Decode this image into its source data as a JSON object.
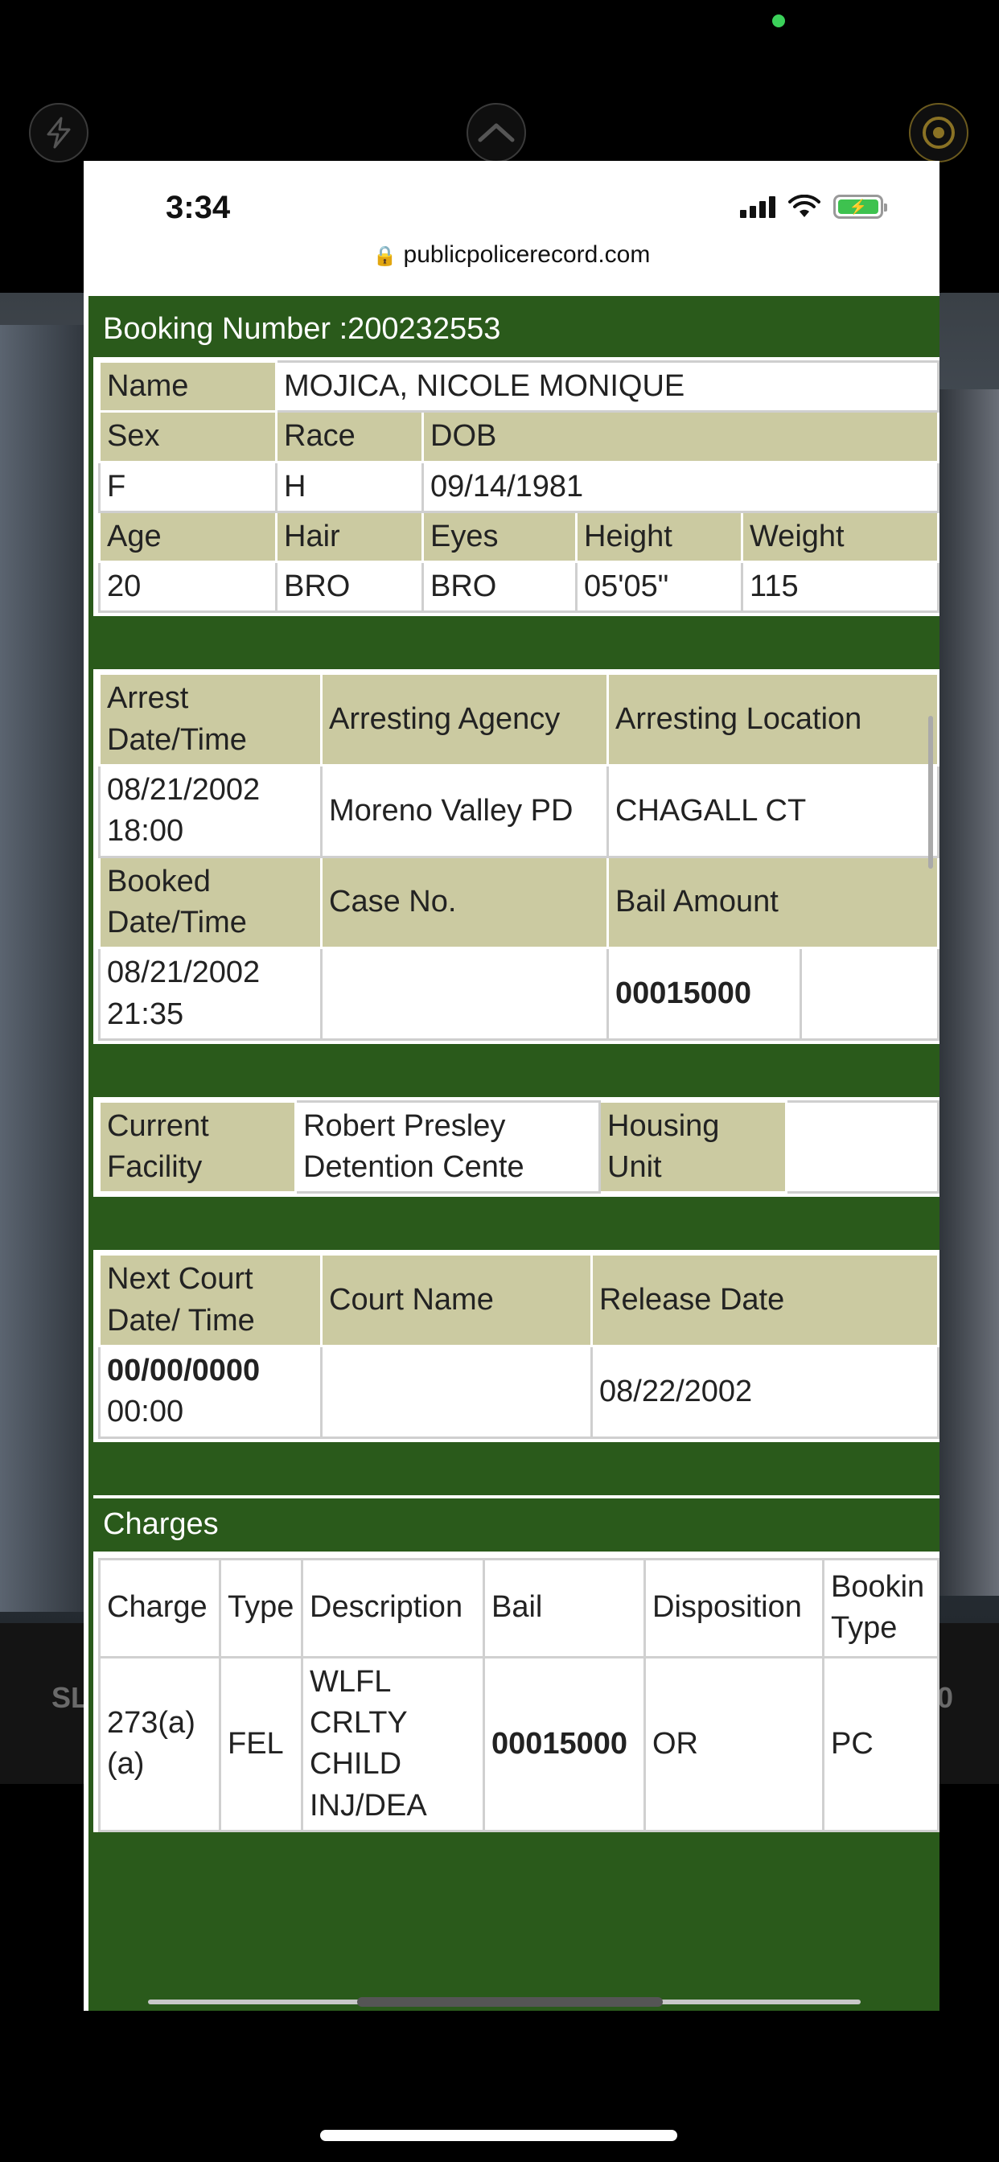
{
  "status_bar": {
    "time": "3:34",
    "url": "publicpolicerecord.com"
  },
  "background": {
    "left_text": "SL",
    "right_text": "0"
  },
  "booking": {
    "title": "Booking Number :200232553",
    "name_label": "Name",
    "name_value": "MOJICA, NICOLE MONIQUE",
    "sex_label": "Sex",
    "race_label": "Race",
    "dob_label": "DOB",
    "sex_value": "F",
    "race_value": "H",
    "dob_value": "09/14/1981",
    "age_label": "Age",
    "hair_label": "Hair",
    "eyes_label": "Eyes",
    "height_label": "Height",
    "weight_label": "Weight",
    "age_value": "20",
    "hair_value": "BRO",
    "eyes_value": "BRO",
    "height_value": "05'05\"",
    "weight_value": "115"
  },
  "arrest": {
    "arrest_dt_label_1": "Arrest",
    "arrest_dt_label_2": "Date/Time",
    "agency_label": "Arresting Agency",
    "location_label": "Arresting Location",
    "arrest_date": "08/21/2002",
    "arrest_time": "18:00",
    "agency_value": "Moreno Valley PD",
    "location_value": "CHAGALL CT",
    "booked_dt_label_1": "Booked",
    "booked_dt_label_2": "Date/Time",
    "case_label": "Case No.",
    "bail_label": "Bail Amount",
    "booked_date": "08/21/2002",
    "booked_time": "21:35",
    "case_value": "",
    "bail_value": "00015000"
  },
  "facility": {
    "current_label_1": "Current",
    "current_label_2": "Facility",
    "facility_value_1": "Robert Presley",
    "facility_value_2": "Detention Cente",
    "housing_label_1": "Housing",
    "housing_label_2": "Unit",
    "housing_value": ""
  },
  "court": {
    "next_label_1": "Next Court",
    "next_label_2": "Date/ Time",
    "court_name_label": "Court Name",
    "release_label": "Release Date",
    "next_date": "00/00/0000",
    "next_time": "00:00",
    "court_name_value": "",
    "release_value": "08/22/2002"
  },
  "charges": {
    "title": "Charges",
    "headers": [
      "Charge",
      "Type",
      "Description",
      "Bail",
      "Disposition",
      "Bookin Type"
    ],
    "header_booking_1": "Bookin",
    "header_booking_2": "Type",
    "row": {
      "charge_1": "273(a)",
      "charge_2": "(a)",
      "type": "FEL",
      "desc_1": "WLFL",
      "desc_2": "CRLTY",
      "desc_3": "CHILD",
      "desc_4": "INJ/DEA",
      "bail": "00015000",
      "disposition": "OR",
      "booking_type": "PC"
    }
  },
  "colors": {
    "header_green": "#2a5a1b",
    "label_khaki": "#cbcaa1",
    "battery_green": "#3ec24f"
  }
}
